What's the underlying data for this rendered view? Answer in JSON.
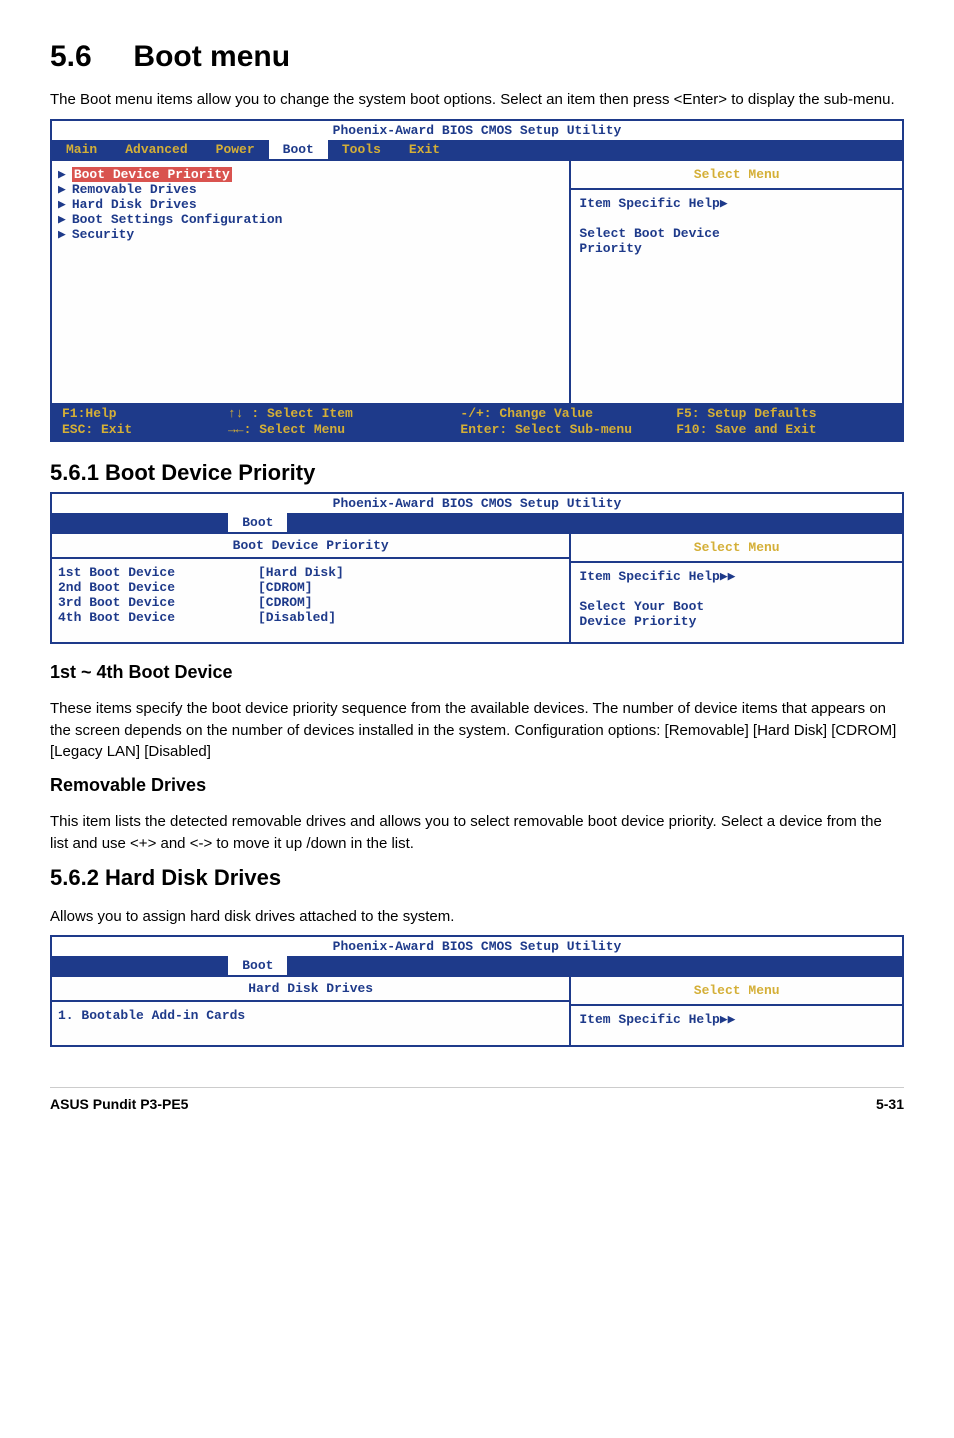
{
  "title": {
    "num": "5.6",
    "text": "Boot menu"
  },
  "intro": "The Boot menu items allow you to change the system boot options. Select an item then press <Enter> to display the sub-menu.",
  "bios1": {
    "title": "Phoenix-Award BIOS CMOS Setup Utility",
    "tabs": [
      "Main",
      "Advanced",
      "Power",
      "Boot",
      "Tools",
      "Exit"
    ],
    "active_tab": "Boot",
    "items": [
      "Boot Device Priority",
      "Removable Drives",
      "Hard Disk Drives",
      "Boot Settings Configuration",
      "Security"
    ],
    "right_label": "Select Menu",
    "help_title": "Item Specific Help",
    "help_body": "Select Boot Device\nPriority",
    "foot": {
      "r1c1": "F1:Help",
      "r1c2": "↑↓ : Select Item",
      "r1c3": "-/+: Change Value",
      "r1c4": "F5: Setup Defaults",
      "r2c1": "ESC: Exit",
      "r2c2": "→←: Select Menu",
      "r2c3": "Enter: Select Sub-menu",
      "r2c4": "F10: Save and Exit"
    }
  },
  "sec561": {
    "heading": "5.6.1  Boot Device Priority",
    "bios_title": "Phoenix-Award BIOS CMOS Setup Utility",
    "tab": "Boot",
    "sub_title": "Boot Device Priority",
    "rows": [
      {
        "k": "1st Boot Device",
        "v": "[Hard Disk]"
      },
      {
        "k": "2nd Boot Device",
        "v": "[CDROM]"
      },
      {
        "k": "3rd Boot Device",
        "v": "[CDROM]"
      },
      {
        "k": "4th Boot Device",
        "v": "[Disabled]"
      }
    ],
    "right_label": "Select Menu",
    "help_title": "Item Specific Help",
    "help_body": "Select Your Boot\nDevice Priority"
  },
  "sub1st": {
    "heading": "1st ~ 4th Boot Device",
    "body": "These items specify the boot device priority sequence from the available devices. The number of device items that appears on the screen depends on the number of devices installed in the system. Configuration options: [Removable] [Hard Disk] [CDROM] [Legacy LAN] [Disabled]"
  },
  "subrem": {
    "heading": "Removable Drives",
    "body": "This item lists the detected removable drives and allows you to select removable boot device priority. Select a device from the list and use <+> and <-> to move it up /down in the list."
  },
  "sec562": {
    "heading": "5.6.2  Hard Disk Drives",
    "intro": "Allows you to assign hard disk drives attached to the system.",
    "bios_title": "Phoenix-Award BIOS CMOS Setup Utility",
    "tab": "Boot",
    "sub_title": "Hard Disk Drives",
    "row": "1. Bootable Add-in Cards",
    "right_label": "Select Menu",
    "help_title": "Item Specific Help"
  },
  "footer": {
    "left": "ASUS Pundit P3-PE5",
    "right": "5-31"
  }
}
